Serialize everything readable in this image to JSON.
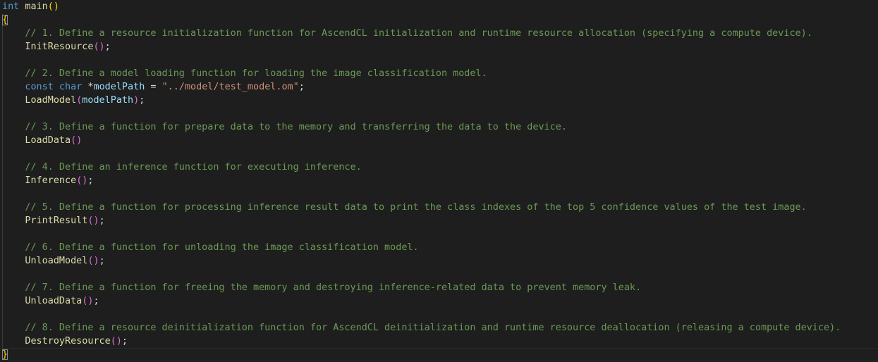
{
  "code": {
    "line1": {
      "type": "int",
      "name": "main",
      "parens": "()"
    },
    "open_brace": "{",
    "close_brace": "}",
    "comments": [
      "// 1. Define a resource initialization function for AscendCL initialization and runtime resource allocation (specifying a compute device).",
      "// 2. Define a model loading function for loading the image classification model.",
      "// 3. Define a function for prepare data to the memory and transferring the data to the device.",
      "// 4. Define an inference function for executing inference.",
      "// 5. Define a function for processing inference result data to print the class indexes of the top 5 confidence values of the test image.",
      "// 6. Define a function for unloading the image classification model.",
      "// 7. Define a function for freeing the memory and destroying inference-related data to prevent memory leak.",
      "// 8. Define a resource deinitialization function for AscendCL deinitialization and runtime resource deallocation (releasing a compute device)."
    ],
    "calls": {
      "init": "InitResource",
      "load_model": "LoadModel",
      "load_data": "LoadData",
      "inference": "Inference",
      "print_result": "PrintResult",
      "unload_model": "UnloadModel",
      "unload_data": "UnloadData",
      "destroy": "DestroyResource"
    },
    "decl": {
      "const": "const",
      "char": "char",
      "star": "*",
      "var": "modelPath",
      "eq": " = ",
      "value": "\"../model/test_model.om\"",
      "semi": ";"
    },
    "arg": "modelPath",
    "empty_args": "()",
    "open_paren": "(",
    "close_paren": ")",
    "semicolon": ";"
  },
  "colors": {
    "background": "#1e1e1e",
    "keyword": "#569cd6",
    "function": "#dcdcaa",
    "identifier": "#9cdcfe",
    "string": "#ce9178",
    "comment": "#6a9955",
    "bracket_level1": "#ffd700",
    "bracket_level2": "#da70d6"
  }
}
